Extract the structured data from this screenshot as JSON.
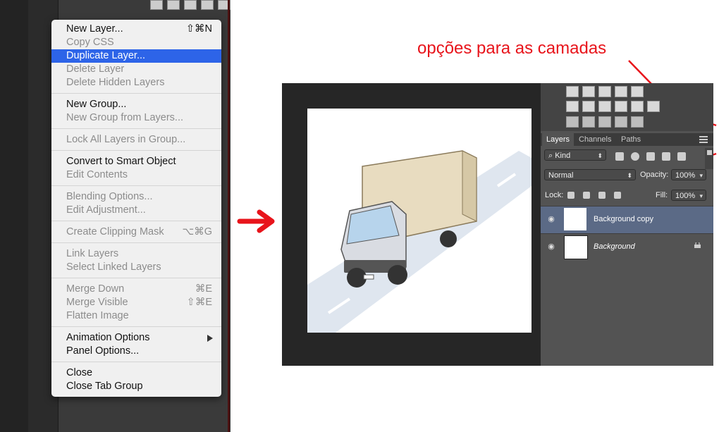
{
  "context_menu": {
    "items": [
      {
        "label": "New Layer...",
        "shortcut": "⇧⌘N",
        "enabled": true
      },
      {
        "label": "Copy CSS",
        "enabled": false
      },
      {
        "label": "Duplicate Layer...",
        "enabled": true,
        "highlighted": true
      },
      {
        "label": "Delete Layer",
        "enabled": false
      },
      {
        "label": "Delete Hidden Layers",
        "enabled": false
      },
      {
        "label": "New Group...",
        "enabled": true
      },
      {
        "label": "New Group from Layers...",
        "enabled": false
      },
      {
        "label": "Lock All Layers in Group...",
        "enabled": false
      },
      {
        "label": "Convert to Smart Object",
        "enabled": true
      },
      {
        "label": "Edit Contents",
        "enabled": false
      },
      {
        "label": "Blending Options...",
        "enabled": false
      },
      {
        "label": "Edit Adjustment...",
        "enabled": false
      },
      {
        "label": "Create Clipping Mask",
        "shortcut": "⌥⌘G",
        "enabled": false
      },
      {
        "label": "Link Layers",
        "enabled": false
      },
      {
        "label": "Select Linked Layers",
        "enabled": false
      },
      {
        "label": "Merge Down",
        "shortcut": "⌘E",
        "enabled": false
      },
      {
        "label": "Merge Visible",
        "shortcut": "⇧⌘E",
        "enabled": false
      },
      {
        "label": "Flatten Image",
        "enabled": false
      },
      {
        "label": "Animation Options",
        "enabled": true,
        "submenu": true
      },
      {
        "label": "Panel Options...",
        "enabled": true
      },
      {
        "label": "Close",
        "enabled": true
      },
      {
        "label": "Close Tab Group",
        "enabled": true
      }
    ]
  },
  "annotation": {
    "text": "opções para as camadas",
    "color": "#e8141b"
  },
  "layers_panel": {
    "tabs": [
      "Layers",
      "Channels",
      "Paths"
    ],
    "active_tab": "Layers",
    "filter_label": "Kind",
    "blend_mode": "Normal",
    "opacity_label": "Opacity:",
    "opacity_value": "100%",
    "lock_label": "Lock:",
    "fill_label": "Fill:",
    "fill_value": "100%",
    "layers": [
      {
        "name": "Background copy",
        "selected": true,
        "visible": true
      },
      {
        "name": "Background",
        "selected": false,
        "visible": true,
        "locked": true
      }
    ],
    "icons": [
      "eye-icon",
      "lock-icon",
      "panel-menu-icon",
      "search-icon"
    ]
  },
  "colors": {
    "highlight": "#2d64e8",
    "selected_layer": "#5b6a86",
    "annotation_red": "#e8141b"
  }
}
